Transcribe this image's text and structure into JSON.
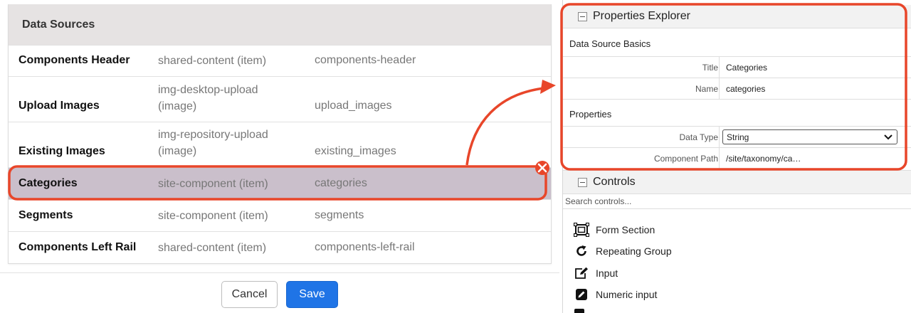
{
  "data_sources": {
    "header": "Data Sources",
    "rows": [
      {
        "name": "Components Header",
        "type": "shared-content (item)",
        "var": "components-header"
      },
      {
        "name": "Upload Images",
        "type_line1": "img-desktop-upload",
        "type_line2": "(image)",
        "var": "upload_images"
      },
      {
        "name": "Existing Images",
        "type_line1": "img-repository-upload",
        "type_line2": "(image)",
        "var": "existing_images"
      },
      {
        "name": "Categories",
        "type": "site-component (item)",
        "var": "categories"
      },
      {
        "name": "Segments",
        "type": "site-component (item)",
        "var": "segments"
      },
      {
        "name": "Components Left Rail",
        "type": "shared-content (item)",
        "var": "components-left-rail"
      }
    ],
    "selected_row": "Categories"
  },
  "footer": {
    "cancel_label": "Cancel",
    "save_label": "Save"
  },
  "properties_explorer": {
    "title": "Properties Explorer",
    "basics_label": "Data Source Basics",
    "title_key": "Title",
    "title_value": "Categories",
    "name_key": "Name",
    "name_value": "categories",
    "properties_label": "Properties",
    "data_type_key": "Data Type",
    "data_type_value": "String",
    "component_path_key": "Component Path",
    "component_path_value": "/site/taxonomy/ca…"
  },
  "controls": {
    "title": "Controls",
    "search_placeholder": "Search controls...",
    "items": [
      {
        "label": "Form Section",
        "icon": "form-section-icon"
      },
      {
        "label": "Repeating Group",
        "icon": "repeat-icon"
      },
      {
        "label": "Input",
        "icon": "edit-input-icon"
      },
      {
        "label": "Numeric input",
        "icon": "pencil-icon"
      }
    ]
  },
  "colors": {
    "highlight": "#e8462a",
    "save_button": "#1f74e6",
    "selected_row": "#cabfcb"
  }
}
